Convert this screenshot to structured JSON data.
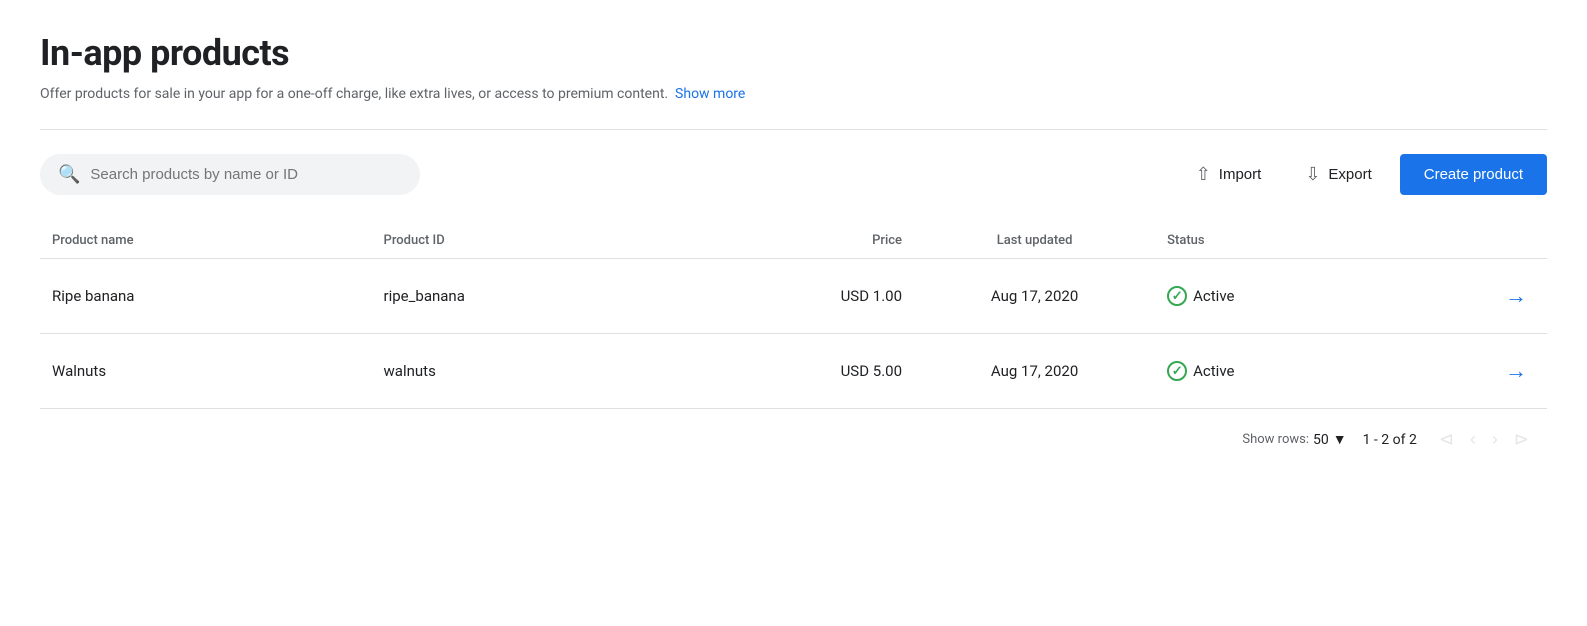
{
  "page": {
    "title": "In-app products",
    "subtitle": "Offer products for sale in your app for a one-off charge, like extra lives, or access to premium content.",
    "show_more_label": "Show more"
  },
  "toolbar": {
    "search_placeholder": "Search products by name or ID",
    "import_label": "Import",
    "export_label": "Export",
    "create_label": "Create product"
  },
  "table": {
    "columns": [
      {
        "key": "name",
        "label": "Product name"
      },
      {
        "key": "id",
        "label": "Product ID"
      },
      {
        "key": "price",
        "label": "Price"
      },
      {
        "key": "updated",
        "label": "Last updated"
      },
      {
        "key": "status",
        "label": "Status"
      }
    ],
    "rows": [
      {
        "name": "Ripe banana",
        "product_id": "ripe_banana",
        "price": "USD 1.00",
        "last_updated": "Aug 17, 2020",
        "status": "Active"
      },
      {
        "name": "Walnuts",
        "product_id": "walnuts",
        "price": "USD 5.00",
        "last_updated": "Aug 17, 2020",
        "status": "Active"
      }
    ]
  },
  "footer": {
    "show_rows_label": "Show rows:",
    "rows_count": "50",
    "pagination_info": "1 - 2 of 2"
  },
  "colors": {
    "accent": "#1a73e8",
    "status_active": "#34a853"
  }
}
